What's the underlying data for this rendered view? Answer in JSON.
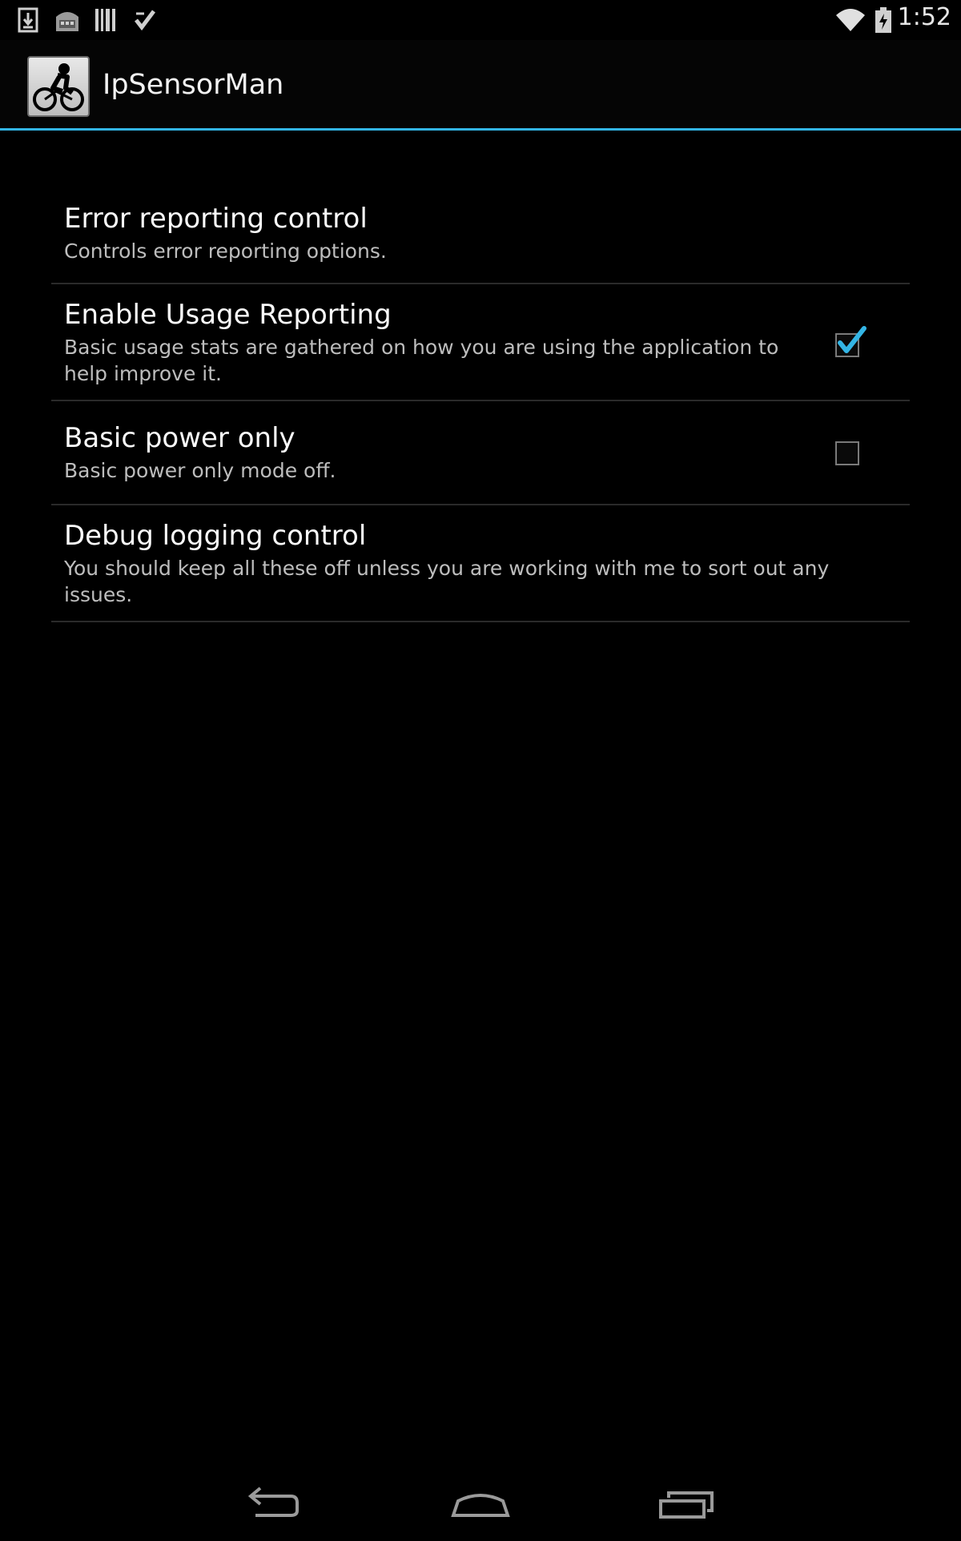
{
  "status_bar": {
    "time": "1:52",
    "left_icons": [
      "download-icon",
      "store-icon",
      "barcode-icon",
      "task-check-icon"
    ],
    "right_icons": [
      "wifi-icon",
      "battery-charging-icon"
    ]
  },
  "action_bar": {
    "app_icon": "bicycle-icon",
    "title": "IpSensorMan",
    "accent_color": "#33b5e5"
  },
  "preferences": [
    {
      "title": "Error reporting control",
      "summary": "Controls error reporting options.",
      "has_checkbox": false
    },
    {
      "title": "Enable Usage Reporting",
      "summary": "Basic usage stats are gathered on how you are using the application to help improve it.",
      "has_checkbox": true,
      "checked": true
    },
    {
      "title": "Basic power only",
      "summary": "Basic power only mode off.",
      "has_checkbox": true,
      "checked": false
    },
    {
      "title": "Debug logging control",
      "summary": "You should keep all these off unless you are working with me to sort out any issues.",
      "has_checkbox": false
    }
  ],
  "nav_bar": {
    "buttons": [
      "back-icon",
      "home-icon",
      "recent-apps-icon"
    ]
  }
}
